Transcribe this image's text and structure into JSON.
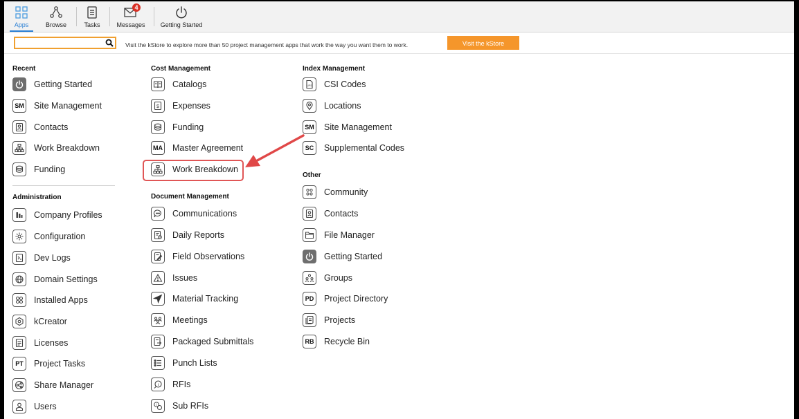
{
  "topnav": {
    "items": [
      {
        "label": "Apps",
        "icon": "apps-grid-icon"
      },
      {
        "label": "Browse",
        "icon": "browse-network-icon"
      },
      {
        "label": "Tasks",
        "icon": "tasks-clipboard-icon"
      },
      {
        "label": "Messages",
        "icon": "envelope-icon",
        "badge": "4"
      },
      {
        "label": "Getting Started",
        "icon": "power-icon"
      }
    ]
  },
  "search": {
    "value": "",
    "placeholder": ""
  },
  "kstore": {
    "text": "Visit the kStore to explore more than 50 project management apps that work the way you want them to work.",
    "button": "Visit the kStore"
  },
  "recent": {
    "heading": "Recent",
    "items": [
      {
        "label": "Getting Started",
        "icon": "power-icon"
      },
      {
        "label": "Site Management",
        "icon": "SM"
      },
      {
        "label": "Contacts",
        "icon": "contacts-icon"
      },
      {
        "label": "Work Breakdown",
        "icon": "hierarchy-icon"
      },
      {
        "label": "Funding",
        "icon": "funding-icon"
      }
    ]
  },
  "administration": {
    "heading": "Administration",
    "items": [
      {
        "label": "Company Profiles",
        "icon": "company-profiles-icon"
      },
      {
        "label": "Configuration",
        "icon": "gear-icon"
      },
      {
        "label": "Dev Logs",
        "icon": "dev-logs-icon"
      },
      {
        "label": "Domain Settings",
        "icon": "globe-icon"
      },
      {
        "label": "Installed Apps",
        "icon": "installed-apps-icon"
      },
      {
        "label": "kCreator",
        "icon": "kcreator-icon"
      },
      {
        "label": "Licenses",
        "icon": "licenses-icon"
      },
      {
        "label": "Project Tasks",
        "icon": "PT"
      },
      {
        "label": "Share Manager",
        "icon": "share-icon"
      },
      {
        "label": "Users",
        "icon": "users-icon"
      }
    ]
  },
  "cost_management": {
    "heading": "Cost Management",
    "items": [
      {
        "label": "Catalogs",
        "icon": "catalog-book-icon"
      },
      {
        "label": "Expenses",
        "icon": "dollar-icon"
      },
      {
        "label": "Funding",
        "icon": "funding-icon"
      },
      {
        "label": "Master Agreement",
        "icon": "MA"
      },
      {
        "label": "Work Breakdown",
        "icon": "hierarchy-icon"
      }
    ]
  },
  "document_management": {
    "heading": "Document Management",
    "items": [
      {
        "label": "Communications",
        "icon": "chat-bubble-icon"
      },
      {
        "label": "Daily Reports",
        "icon": "daily-report-icon"
      },
      {
        "label": "Field Observations",
        "icon": "edit-document-icon"
      },
      {
        "label": "Issues",
        "icon": "warning-icon"
      },
      {
        "label": "Material Tracking",
        "icon": "send-arrow-icon"
      },
      {
        "label": "Meetings",
        "icon": "meetings-icon"
      },
      {
        "label": "Packaged Submittals",
        "icon": "submittals-icon"
      },
      {
        "label": "Punch Lists",
        "icon": "list-icon"
      },
      {
        "label": "RFIs",
        "icon": "rfi-icon"
      },
      {
        "label": "Sub RFIs",
        "icon": "sub-rfi-icon"
      }
    ]
  },
  "index_management": {
    "heading": "Index Management",
    "items": [
      {
        "label": "CSI Codes",
        "icon": "csi-document-icon"
      },
      {
        "label": "Locations",
        "icon": "location-pin-icon"
      },
      {
        "label": "Site Management",
        "icon": "SM"
      },
      {
        "label": "Supplemental Codes",
        "icon": "SC"
      }
    ]
  },
  "other": {
    "heading": "Other",
    "items": [
      {
        "label": "Community",
        "icon": "community-icon"
      },
      {
        "label": "Contacts",
        "icon": "contacts-icon"
      },
      {
        "label": "File Manager",
        "icon": "folder-icon"
      },
      {
        "label": "Getting Started",
        "icon": "power-icon"
      },
      {
        "label": "Groups",
        "icon": "groups-icon"
      },
      {
        "label": "Project Directory",
        "icon": "PD"
      },
      {
        "label": "Projects",
        "icon": "projects-icon"
      },
      {
        "label": "Recycle Bin",
        "icon": "RB"
      }
    ]
  },
  "colors": {
    "accent": "#2a7fd4",
    "kstore_button": "#f5962b",
    "highlight": "#e05656",
    "badge": "#d93025"
  }
}
